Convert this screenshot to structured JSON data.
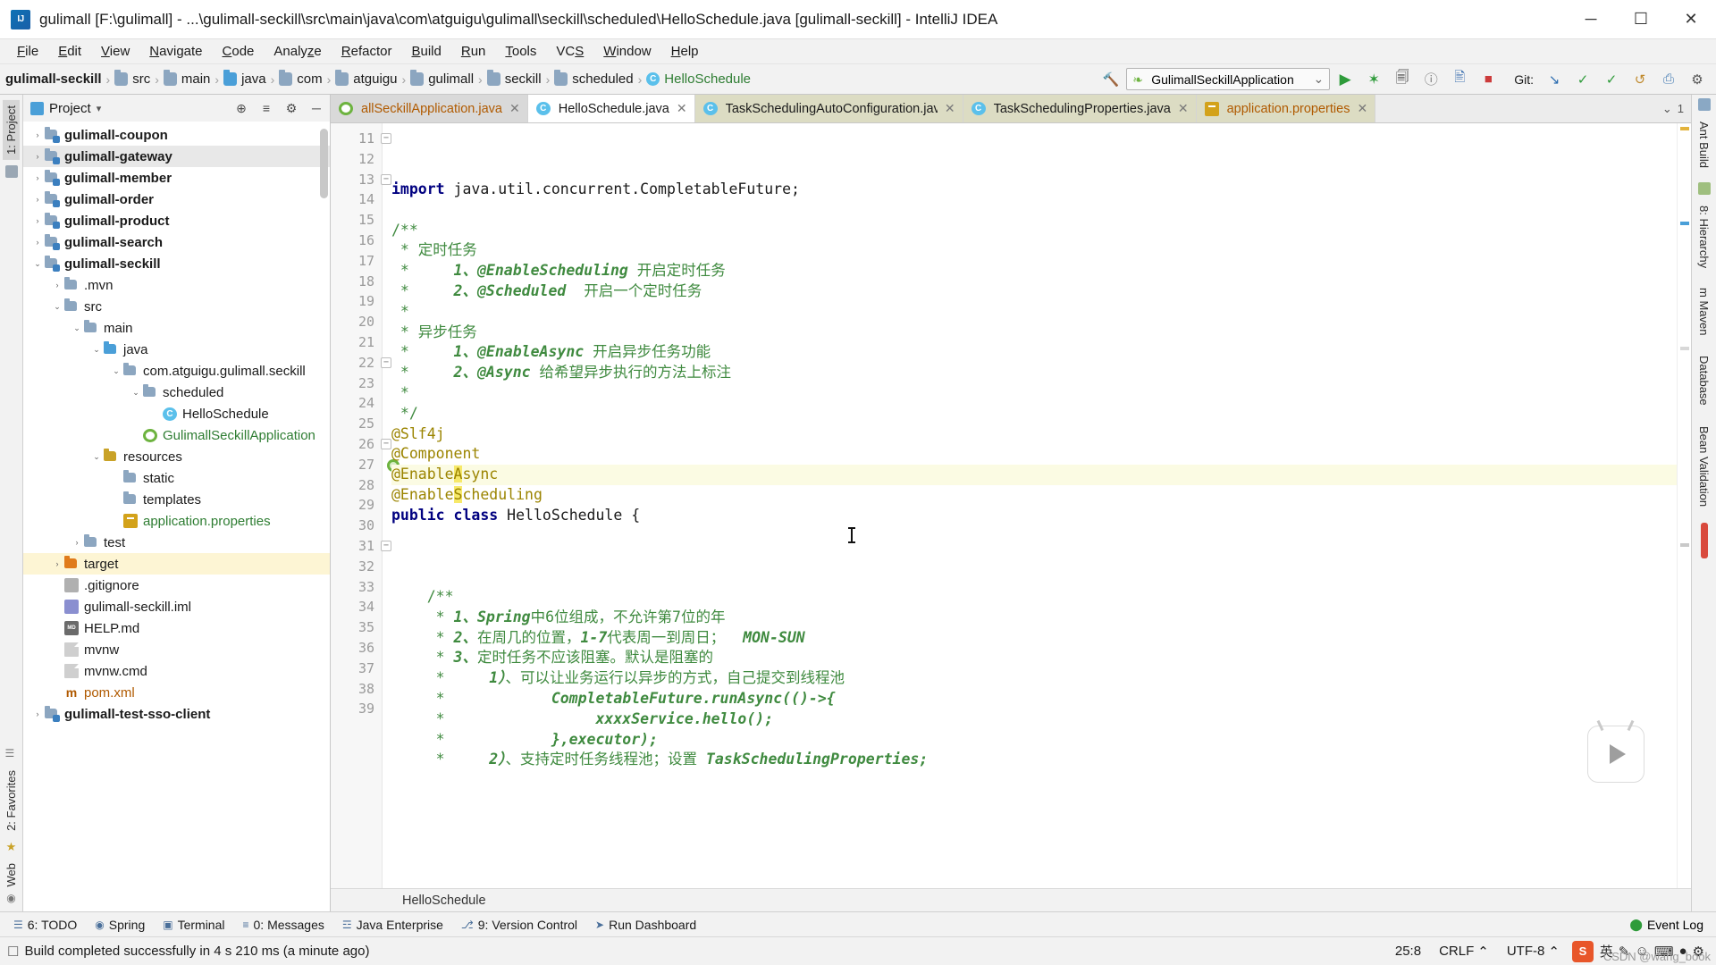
{
  "window": {
    "title": "gulimall [F:\\gulimall] - ...\\gulimall-seckill\\src\\main\\java\\com\\atguigu\\gulimall\\seckill\\scheduled\\HelloSchedule.java [gulimall-seckill] - IntelliJ IDEA",
    "minimize": "─",
    "maximize": "☐",
    "close": "✕"
  },
  "menu": [
    "File",
    "Edit",
    "View",
    "Navigate",
    "Code",
    "Analyze",
    "Refactor",
    "Build",
    "Run",
    "Tools",
    "VCS",
    "Window",
    "Help"
  ],
  "breadcrumb": {
    "items": [
      {
        "label": "gulimall-seckill",
        "type": "module"
      },
      {
        "label": "src",
        "type": "folder"
      },
      {
        "label": "main",
        "type": "folder"
      },
      {
        "label": "java",
        "type": "source-folder"
      },
      {
        "label": "com",
        "type": "folder"
      },
      {
        "label": "atguigu",
        "type": "folder"
      },
      {
        "label": "gulimall",
        "type": "folder"
      },
      {
        "label": "seckill",
        "type": "folder"
      },
      {
        "label": "scheduled",
        "type": "folder"
      },
      {
        "label": "HelloSchedule",
        "type": "class"
      }
    ],
    "separator": "›"
  },
  "toolbar": {
    "run_config": "GulimallSeckillApplication",
    "dropdown_caret": "⌄",
    "git_label": "Git:",
    "buttons": [
      {
        "name": "run",
        "glyph": "▶"
      },
      {
        "name": "debug",
        "glyph": "✶"
      },
      {
        "name": "run-with-coverage",
        "glyph": "⬡"
      },
      {
        "name": "profiler",
        "glyph": "ⓘ"
      },
      {
        "name": "attach-debugger",
        "glyph": "⌘"
      },
      {
        "name": "stop",
        "glyph": "■"
      }
    ],
    "git_buttons": [
      {
        "name": "update-project",
        "glyph": "↙"
      },
      {
        "name": "commit",
        "glyph": "✓"
      },
      {
        "name": "push",
        "glyph": "↑"
      },
      {
        "name": "rollback",
        "glyph": "↺"
      },
      {
        "name": "search-everywhere",
        "glyph": "⚲"
      },
      {
        "name": "settings",
        "glyph": "⚙"
      }
    ]
  },
  "left_strip": {
    "top_tabs": [
      "1: Project"
    ],
    "bottom_tabs": [
      "2: Favorites",
      "Web"
    ]
  },
  "right_strip": {
    "tabs": [
      "Ant Build",
      "8: Hierarchy",
      "m Maven",
      "Database",
      "Bean Validation"
    ]
  },
  "project_panel": {
    "title": "Project",
    "caret": "▾",
    "actions": [
      {
        "name": "locate-file",
        "glyph": "⊕"
      },
      {
        "name": "collapse-all",
        "glyph": "≡"
      },
      {
        "name": "settings",
        "glyph": "⚙"
      },
      {
        "name": "hide",
        "glyph": "─"
      }
    ],
    "tree": [
      {
        "label": "gulimall-coupon",
        "indent": 1,
        "arrow": "›",
        "icon": "mod",
        "bold": true
      },
      {
        "label": "gulimall-gateway",
        "indent": 1,
        "arrow": "›",
        "icon": "mod",
        "bold": true,
        "row": "hl"
      },
      {
        "label": "gulimall-member",
        "indent": 1,
        "arrow": "›",
        "icon": "mod",
        "bold": true
      },
      {
        "label": "gulimall-order",
        "indent": 1,
        "arrow": "›",
        "icon": "mod",
        "bold": true
      },
      {
        "label": "gulimall-product",
        "indent": 1,
        "arrow": "›",
        "icon": "mod",
        "bold": true
      },
      {
        "label": "gulimall-search",
        "indent": 1,
        "arrow": "›",
        "icon": "mod",
        "bold": true
      },
      {
        "label": "gulimall-seckill",
        "indent": 1,
        "arrow": "⌄",
        "icon": "mod",
        "bold": true
      },
      {
        "label": ".mvn",
        "indent": 2,
        "arrow": "›",
        "icon": "plain"
      },
      {
        "label": "src",
        "indent": 2,
        "arrow": "⌄",
        "icon": "plain"
      },
      {
        "label": "main",
        "indent": 3,
        "arrow": "⌄",
        "icon": "plain"
      },
      {
        "label": "java",
        "indent": 4,
        "arrow": "⌄",
        "icon": "src"
      },
      {
        "label": "com.atguigu.gulimall.seckill",
        "indent": 5,
        "arrow": "⌄",
        "icon": "plain"
      },
      {
        "label": "scheduled",
        "indent": 6,
        "arrow": "⌄",
        "icon": "plain"
      },
      {
        "label": "HelloSchedule",
        "indent": 7,
        "arrow": "",
        "icon": "class"
      },
      {
        "label": "GulimallSeckillApplication",
        "indent": 6,
        "arrow": "",
        "icon": "spring",
        "color": "green"
      },
      {
        "label": "resources",
        "indent": 4,
        "arrow": "⌄",
        "icon": "res"
      },
      {
        "label": "static",
        "indent": 5,
        "arrow": "",
        "icon": "plain"
      },
      {
        "label": "templates",
        "indent": 5,
        "arrow": "",
        "icon": "plain"
      },
      {
        "label": "application.properties",
        "indent": 5,
        "arrow": "",
        "icon": "props",
        "color": "green"
      },
      {
        "label": "test",
        "indent": 3,
        "arrow": "›",
        "icon": "plain"
      },
      {
        "label": "target",
        "indent": 2,
        "arrow": "›",
        "icon": "target",
        "row": "hl2"
      },
      {
        "label": ".gitignore",
        "indent": 2,
        "arrow": "",
        "icon": "git"
      },
      {
        "label": "gulimall-seckill.iml",
        "indent": 2,
        "arrow": "",
        "icon": "iml"
      },
      {
        "label": "HELP.md",
        "indent": 2,
        "arrow": "",
        "icon": "md"
      },
      {
        "label": "mvnw",
        "indent": 2,
        "arrow": "",
        "icon": "file"
      },
      {
        "label": "mvnw.cmd",
        "indent": 2,
        "arrow": "",
        "icon": "file"
      },
      {
        "label": "pom.xml",
        "indent": 2,
        "arrow": "",
        "icon": "maven",
        "color": "orange"
      },
      {
        "label": "gulimall-test-sso-client",
        "indent": 1,
        "arrow": "›",
        "icon": "mod",
        "bold": true
      }
    ]
  },
  "editor_tabs": [
    {
      "label": "allSeckillApplication.java",
      "icon": "spring",
      "state": "dim",
      "close": "✕",
      "color": "orange"
    },
    {
      "label": "HelloSchedule.java",
      "icon": "class",
      "state": "active",
      "close": "✕"
    },
    {
      "label": "TaskSchedulingAutoConfiguration.java",
      "icon": "class",
      "state": "olive",
      "close": "✕"
    },
    {
      "label": "TaskSchedulingProperties.java",
      "icon": "class",
      "state": "olive",
      "close": "✕"
    },
    {
      "label": "application.properties",
      "icon": "props",
      "state": "olive",
      "close": "✕",
      "color": "orange"
    }
  ],
  "editor_tabbar_right": {
    "overflow": "⌄",
    "count": "1"
  },
  "code": {
    "first_line_number": 11,
    "lines": [
      {
        "n": 11,
        "fold": "−",
        "html": "<span class='kw'>import</span> <span class='plain'>java.util.concurrent.CompletableFuture;</span>"
      },
      {
        "n": 12,
        "html": ""
      },
      {
        "n": 13,
        "fold": "−",
        "html": "<span class='cmt'>/**</span>"
      },
      {
        "n": 14,
        "html": "<span class='cmt'> * 定时任务</span>"
      },
      {
        "n": 15,
        "html": "<span class='cmt'> *     </span><span class='cmt-em'>1、@EnableScheduling</span><span class='cmt'> 开启定时任务</span>"
      },
      {
        "n": 16,
        "html": "<span class='cmt'> *     </span><span class='cmt-em'>2、@Scheduled</span><span class='cmt'>  开启一个定时任务</span>"
      },
      {
        "n": 17,
        "html": "<span class='cmt'> *</span>"
      },
      {
        "n": 18,
        "html": "<span class='cmt'> * 异步任务</span>"
      },
      {
        "n": 19,
        "html": "<span class='cmt'> *     </span><span class='cmt-em'>1、@EnableAsync</span><span class='cmt'> 开启异步任务功能</span>"
      },
      {
        "n": 20,
        "html": "<span class='cmt'> *     </span><span class='cmt-em'>2、@Async</span><span class='cmt'> 给希望异步执行的方法上标注</span>"
      },
      {
        "n": 21,
        "html": "<span class='cmt'> *</span>"
      },
      {
        "n": 22,
        "fold": "−",
        "html": "<span class='cmt'> */</span>"
      },
      {
        "n": 23,
        "html": "<span class='ann'>@Slf4j</span>"
      },
      {
        "n": 24,
        "html": "<span class='ann'>@Component</span>"
      },
      {
        "n": 25,
        "hl": true,
        "html": "<span class='ann'>@Enable</span><span class='ann hlword'>A</span><span class='ann'>sync</span>"
      },
      {
        "n": 26,
        "fold": "−",
        "html": "<span class='ann'>@Enable</span><span class='ann hlword'>S</span><span class='ann'>cheduling</span>"
      },
      {
        "n": 27,
        "spring": true,
        "html": "<span class='kw'>public</span> <span class='kw'>class</span> <span class='plain'>HelloSchedule {</span>"
      },
      {
        "n": 28,
        "html": ""
      },
      {
        "n": 29,
        "html": ""
      },
      {
        "n": 30,
        "html": ""
      },
      {
        "n": 31,
        "fold": "−",
        "html": "<span class='cmt'>    /**</span>"
      },
      {
        "n": 32,
        "html": "<span class='cmt'>     * </span><span class='cmt-em'>1、Spring</span><span class='cmt'>中6位组成，不允许第7位的年</span>"
      },
      {
        "n": 33,
        "html": "<span class='cmt'>     * </span><span class='cmt-em'>2、</span><span class='cmt'>在周几的位置，</span><span class='cmt-em'>1-7</span><span class='cmt'>代表周一到周日；  </span><span class='cmt-em'>MON-SUN</span>"
      },
      {
        "n": 34,
        "html": "<span class='cmt'>     * </span><span class='cmt-em'>3、</span><span class='cmt'>定时任务不应该阻塞。默认是阻塞的</span>"
      },
      {
        "n": 35,
        "html": "<span class='cmt'>     *     </span><span class='cmt-em'>1）</span><span class='cmt'>、可以让业务运行以异步的方式，自己提交到线程池</span>"
      },
      {
        "n": 36,
        "html": "<span class='cmt'>     *            </span><span class='cmt-em'>CompletableFuture.runAsync(()-&gt;{</span>"
      },
      {
        "n": 37,
        "html": "<span class='cmt'>     *                 </span><span class='cmt-em'>xxxxService.hello();</span>"
      },
      {
        "n": 38,
        "html": "<span class='cmt'>     *            </span><span class='cmt-em'>},executor);</span>"
      },
      {
        "n": 39,
        "html": "<span class='cmt'>     *     </span><span class='cmt-em'>2）</span><span class='cmt'>、支持定时任务线程池；设置 </span><span class='cmt-em'>TaskSchedulingProperties;</span>"
      }
    ]
  },
  "editor_breadcrumb": "HelloSchedule",
  "bottom_toolwindows": [
    {
      "label": "6: TODO",
      "glyph": "☰"
    },
    {
      "label": "Spring",
      "glyph": "◉"
    },
    {
      "label": "Terminal",
      "glyph": "▣"
    },
    {
      "label": "0: Messages",
      "glyph": "≡"
    },
    {
      "label": "Java Enterprise",
      "glyph": "☲"
    },
    {
      "label": "9: Version Control",
      "glyph": "⎇"
    },
    {
      "label": "Run Dashboard",
      "glyph": "➤"
    }
  ],
  "event_log": {
    "label": "Event Log",
    "glyph": "⬤"
  },
  "status": {
    "message": "Build completed successfully in 4 s 210 ms (a minute ago)",
    "caret_position": "25:8",
    "line_separator": "CRLF",
    "encoding": "UTF-8",
    "separator_caret": "⌃",
    "ime": "英",
    "ime_icons": [
      "✎",
      "☺",
      "⌨",
      "●",
      "⚙"
    ],
    "lock_glyph": "☐"
  },
  "watermark": "CSDN @wang_book",
  "colors": {
    "accent_green": "#2e7d32",
    "annotation": "#9b8400",
    "comment": "#3f8a3f",
    "keyword": "#000080",
    "highlight_row": "#fbfbe3",
    "highlight_word": "#f7e96a",
    "tab_active": "#ffffff",
    "tab_olive": "#dcdcc3"
  }
}
